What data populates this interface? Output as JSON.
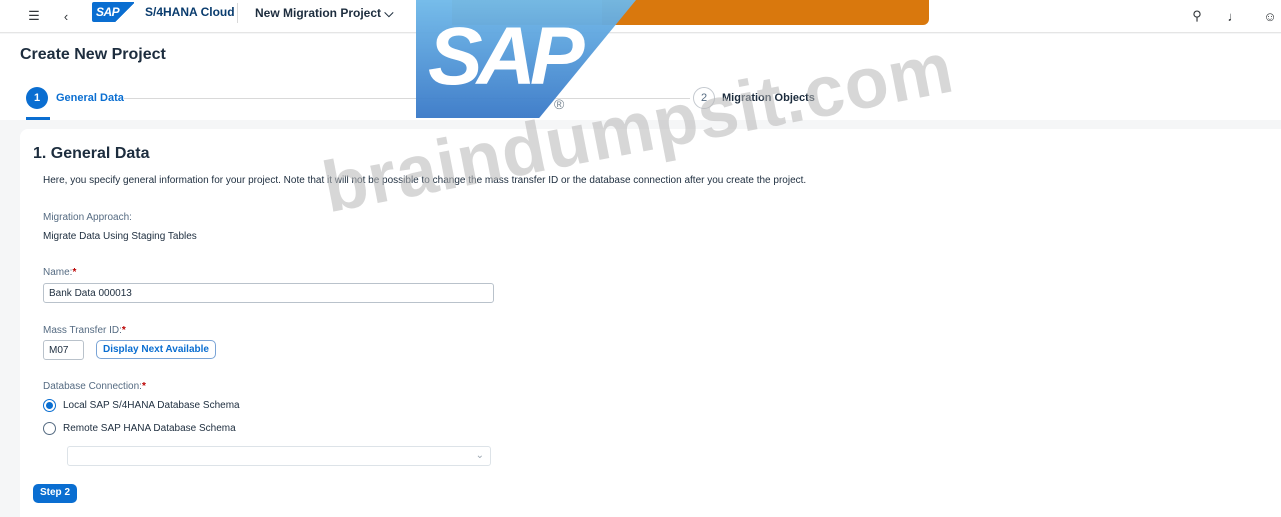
{
  "shell": {
    "menu_icon": "hamburger-icon",
    "back_icon": "chevron-left-icon",
    "logo_text": "SAP",
    "product": "S/4HANA Cloud",
    "app_title": "New Migration Project ⌵",
    "search_icon": "search-icon",
    "bell_icon": "bell-icon",
    "user_icon": "user-icon"
  },
  "header": {
    "page_title": "Create New Project",
    "steps": [
      {
        "number": "1",
        "label": "General Data"
      },
      {
        "number": "2",
        "label": "Migration Objects"
      }
    ]
  },
  "watermarks": {
    "sap_logo_text": "SAP",
    "registered": "®",
    "site_text": "braindumpsit.com"
  },
  "form": {
    "section_title": "1. General Data",
    "description": "Here, you specify general information for your project. Note that it will not be possible to change the mass transfer ID or the database connection after you create the project.",
    "migration_approach_label": "Migration Approach:",
    "migration_approach_value": "Migrate Data Using Staging Tables",
    "name_label": "Name:",
    "name_value": "Bank Data 000013",
    "mass_transfer_label": "Mass Transfer ID:",
    "mass_transfer_value": "M07",
    "display_next_button": "Display Next Available",
    "db_connection_label": "Database Connection:",
    "required_marker": "*",
    "radio_local": "Local SAP S/4HANA Database Schema",
    "radio_remote": "Remote SAP HANA Database Schema",
    "selected_radio": "local",
    "remote_select_value": "",
    "step2_button": "Step 2"
  }
}
